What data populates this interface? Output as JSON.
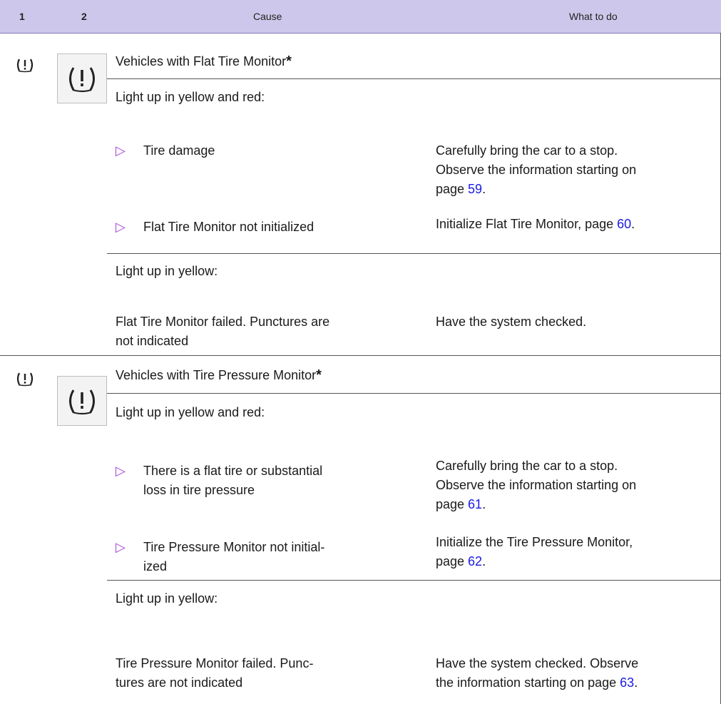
{
  "header": {
    "col1": "1",
    "col2": "2",
    "cause": "Cause",
    "what": "What to do"
  },
  "icons": {
    "small": "tire-pressure-warning-icon",
    "large": "tire-pressure-warning-icon"
  },
  "sections": [
    {
      "title": "Vehicles with Flat Tire Monitor",
      "title_star": "*",
      "group1": {
        "heading": "Light up in yellow and red:",
        "items": [
          {
            "bullet": "▷",
            "cause": "Tire damage",
            "action_lines": [
              "Carefully bring the car to a stop.",
              "Observe the information starting on",
              "page "
            ],
            "page": "59",
            "tail": "."
          },
          {
            "bullet": "▷",
            "cause": "Flat Tire Monitor not initialized",
            "action_lines": [
              "Initialize Flat Tire Monitor, page "
            ],
            "page": "60",
            "tail": "."
          }
        ]
      },
      "group2": {
        "heading": "Light up in yellow:",
        "cause_lines": [
          "Flat Tire Monitor failed. Punctures are",
          "not indicated"
        ],
        "action": "Have the system checked."
      }
    },
    {
      "title": "Vehicles with Tire Pressure Monitor",
      "title_star": "*",
      "group1": {
        "heading": "Light up in yellow and red:",
        "items": [
          {
            "bullet": "▷",
            "cause_lines": [
              "There is a flat tire or substantial",
              "loss in tire pressure"
            ],
            "action_lines": [
              "Carefully bring the car to a stop.",
              "Observe the information starting on",
              "page "
            ],
            "page": "61",
            "tail": "."
          },
          {
            "bullet": "▷",
            "cause_lines": [
              "Tire Pressure Monitor not initial-",
              "ized"
            ],
            "action_lines": [
              "Initialize the Tire Pressure Monitor,",
              "page "
            ],
            "page": "62",
            "tail": "."
          }
        ]
      },
      "group2": {
        "heading": "Light up in yellow:",
        "cause_lines": [
          "Tire Pressure Monitor failed. Punc-",
          "tures are not indicated"
        ],
        "action_lines": [
          "Have the system checked. Observe",
          "the information starting on page "
        ],
        "page": "63",
        "tail": "."
      }
    }
  ]
}
